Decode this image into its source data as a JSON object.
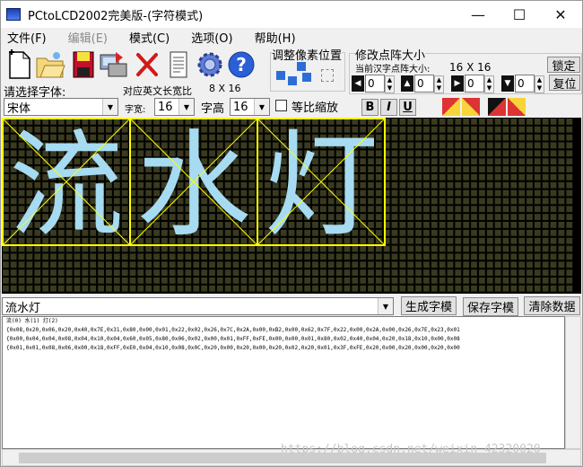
{
  "window": {
    "title": "PCtoLCD2002完美版-(字符模式)",
    "minimize_glyph": "—",
    "maximize_glyph": "☐",
    "close_glyph": "✕"
  },
  "menu": [
    {
      "label": "文件(F)",
      "enabled": true
    },
    {
      "label": "编辑(E)",
      "enabled": false
    },
    {
      "label": "模式(C)",
      "enabled": true
    },
    {
      "label": "选项(O)",
      "enabled": true
    },
    {
      "label": "帮助(H)",
      "enabled": true
    }
  ],
  "toolbar_icons": [
    "new-document-icon",
    "open-folder-icon",
    "save-icon",
    "export-icon",
    "delete-icon",
    "notepad-icon",
    "settings-gear-icon",
    "help-icon"
  ],
  "font_panel": {
    "label": "请选择字体:",
    "font_value": "宋体",
    "ratio_label": "对应英文长宽比",
    "ratio_value": "8 X 16",
    "width_label": "字宽:",
    "width_value": "16",
    "height_label": "字高",
    "height_value": "16",
    "proportional_label": "等比缩放",
    "bold": "B",
    "italic": "I",
    "underline": "U"
  },
  "pixel_adjust": {
    "title": "调整像素位置"
  },
  "matrix_panel": {
    "title": "修改点阵大小",
    "current_label": "当前汉字点阵大小:",
    "current_value": "16 X 16",
    "lock_button": "锁定",
    "reset_button": "复位",
    "spin_values": [
      "0",
      "0",
      "0",
      "0"
    ]
  },
  "preview": {
    "colors": {
      "background": "#000000",
      "cell_off": "#3a3a20",
      "cell_on": "#a6dbf2",
      "frame": "#ffff00"
    },
    "characters": [
      "流",
      "水",
      "灯"
    ]
  },
  "input": {
    "text": "流水灯",
    "generate_button": "生成字模",
    "save_button": "保存字模",
    "clear_button": "清除数据"
  },
  "output": {
    "lines": [
      "流(0) 水(1) 灯(2)",
      "",
      "{0x08,0x20,0x06,0x20,0x40,0x7E,0x31,0x80,0x00,0x01,0x22,0x02,0x26,0x7C,0x2A,0x00,0xB2,0x00,0x62,0x7F,0x22,0x00,0x2A,0x00,0x26,0x7E,0x23,0x01",
      "{0x00,0x04,0x04,0x08,0x04,0x10,0x04,0x60,0x05,0x80,0x06,0x02,0x00,0x01,0xFF,0xFE,0x00,0x00,0x01,0x80,0x02,0x40,0x04,0x20,0x18,0x10,0x00,0x08",
      "{0x01,0x01,0x08,0x06,0x00,0x18,0xFF,0xE0,0x04,0x10,0x08,0x0C,0x20,0x00,0x20,0x00,0x20,0x02,0x20,0x01,0x3F,0xFE,0x20,0x00,0x20,0x00,0x20,0x00"
    ]
  },
  "watermark": "https://blog.csdn.net/weixin_42320020"
}
